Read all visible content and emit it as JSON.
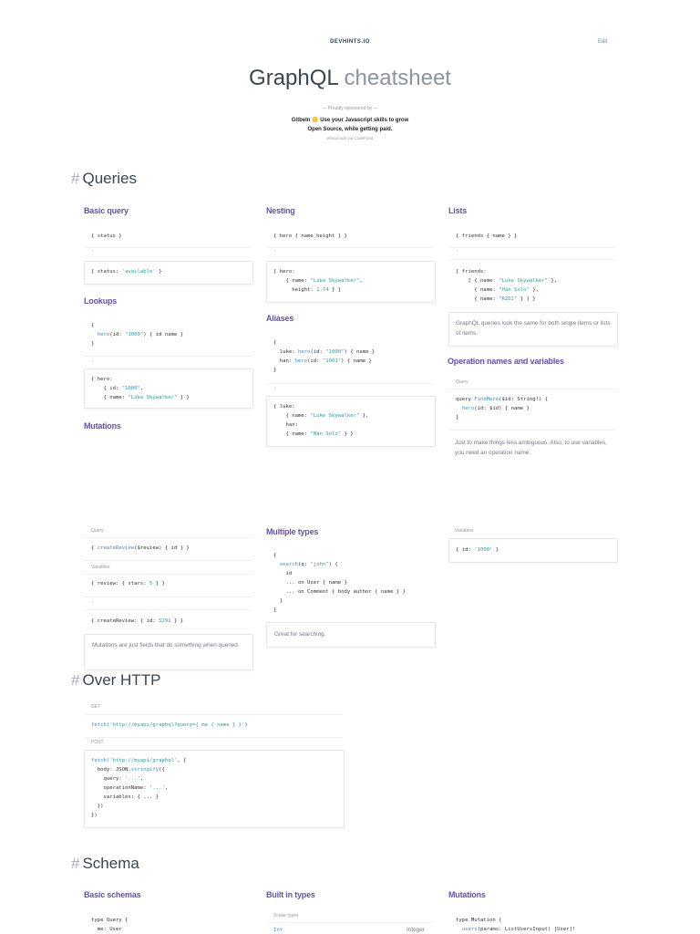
{
  "header": {
    "brand": "DEVHINTS.IO",
    "edit": "Edit",
    "title_main": "GraphQL",
    "title_light": "cheatsheet"
  },
  "sponsor": {
    "label": "— Proudly sponsored by —",
    "line1": "Gitbeln 🪙 Use your Javascript skills to grow",
    "line2": "Open Source, while getting paid.",
    "footer": "ethical ads via CodeFund"
  },
  "sections": {
    "queries": "Queries",
    "http": "Over HTTP",
    "schema": "Schema"
  },
  "arrow": "↓",
  "queries": {
    "basic": {
      "title": "Basic query",
      "q": [
        [
          [
            "{ status }",
            ""
          ]
        ]
      ],
      "r": [
        [
          [
            "{ status: ",
            ""
          ],
          [
            "'available'",
            "s"
          ],
          [
            " }",
            ""
          ]
        ]
      ]
    },
    "lookups": {
      "title": "Lookups",
      "q": [
        [
          [
            "{",
            ""
          ]
        ],
        [
          [
            "  ",
            ""
          ],
          [
            "hero",
            "f"
          ],
          [
            "(id: ",
            ""
          ],
          [
            "\"1000\"",
            "s"
          ],
          [
            ") { id name }",
            ""
          ]
        ],
        [
          [
            "}",
            ""
          ]
        ]
      ],
      "r": [
        [
          [
            "{ hero:",
            ""
          ]
        ],
        [
          [
            "    { id: ",
            ""
          ],
          [
            "\"1000\"",
            "s"
          ],
          [
            ",",
            ""
          ]
        ],
        [
          [
            "    { name: ",
            ""
          ],
          [
            "\"Luke Skywalker\"",
            "s"
          ],
          [
            " } }",
            ""
          ]
        ]
      ]
    },
    "mutations": {
      "title": "Mutations",
      "query_label": "Query",
      "q": [
        [
          [
            "{ ",
            ""
          ],
          [
            "createReview",
            "f"
          ],
          [
            "($review) { id } }",
            ""
          ]
        ]
      ],
      "variables_label": "Variables",
      "v": [
        [
          [
            "{ review: { stars: ",
            ""
          ],
          [
            "5",
            "s"
          ],
          [
            " } }",
            ""
          ]
        ]
      ],
      "r": [
        [
          [
            "{ createReview: { id: ",
            ""
          ],
          [
            "5291",
            "s"
          ],
          [
            " } }",
            ""
          ]
        ]
      ],
      "note": "Mutations are just fields that do something when queried.",
      "vars_label2": "Variables",
      "v2": [
        [
          [
            "{ id: ",
            ""
          ],
          [
            "'1000'",
            "s"
          ],
          [
            " }",
            ""
          ]
        ]
      ]
    },
    "nesting": {
      "title": "Nesting",
      "q": [
        [
          [
            "{ hero { name height } }",
            ""
          ]
        ]
      ],
      "r": [
        [
          [
            "{ hero:",
            ""
          ]
        ],
        [
          [
            "    { name: ",
            ""
          ],
          [
            "\"Luke Skywalker\"",
            "s"
          ],
          [
            ",",
            ""
          ]
        ],
        [
          [
            "      height: ",
            ""
          ],
          [
            "1.74",
            "s"
          ],
          [
            " } }",
            ""
          ]
        ]
      ]
    },
    "aliases": {
      "title": "Aliases",
      "q": [
        [
          [
            "{",
            ""
          ]
        ],
        [
          [
            "  luke: ",
            ""
          ],
          [
            "hero",
            "f"
          ],
          [
            "(id: ",
            ""
          ],
          [
            "\"1000\"",
            "s"
          ],
          [
            ") { name }",
            ""
          ]
        ],
        [
          [
            "  han: ",
            ""
          ],
          [
            "hero",
            "f"
          ],
          [
            "(id: ",
            ""
          ],
          [
            "\"1001\"",
            "s"
          ],
          [
            ") { name }",
            ""
          ]
        ],
        [
          [
            "}",
            ""
          ]
        ]
      ],
      "r": [
        [
          [
            "{ luke:",
            ""
          ]
        ],
        [
          [
            "    { name: ",
            ""
          ],
          [
            "\"Luke Skywalker\"",
            "s"
          ],
          [
            " },",
            ""
          ]
        ],
        [
          [
            "    han:",
            ""
          ]
        ],
        [
          [
            "    { name: ",
            ""
          ],
          [
            "\"Han Solo\"",
            "s"
          ],
          [
            " } }",
            ""
          ]
        ]
      ]
    },
    "multiple": {
      "title": "Multiple types",
      "q": [
        [
          [
            "{",
            ""
          ]
        ],
        [
          [
            "  ",
            ""
          ],
          [
            "search",
            "f"
          ],
          [
            "(q: ",
            ""
          ],
          [
            "\"john\"",
            "s"
          ],
          [
            ") {",
            ""
          ]
        ],
        [
          [
            "    id",
            ""
          ]
        ],
        [
          [
            "    ... on User { name }",
            ""
          ]
        ],
        [
          [
            "    ... on Comment { body author { name } }",
            ""
          ]
        ],
        [
          [
            "  }",
            ""
          ]
        ],
        [
          [
            "}",
            ""
          ]
        ]
      ],
      "note": "Great for searching."
    },
    "lists": {
      "title": "Lists",
      "q": [
        [
          [
            "{ friends { name } }",
            ""
          ]
        ]
      ],
      "r": [
        [
          [
            "{ friends:",
            ""
          ]
        ],
        [
          [
            "    [ { name: ",
            ""
          ],
          [
            "\"Luke Skywalker\"",
            "s"
          ],
          [
            " },",
            ""
          ]
        ],
        [
          [
            "      { name: ",
            ""
          ],
          [
            "\"Han Solo\"",
            "s"
          ],
          [
            " },",
            ""
          ]
        ],
        [
          [
            "      { name: ",
            ""
          ],
          [
            "\"R2D2\"",
            "s"
          ],
          [
            " } ] }",
            ""
          ]
        ]
      ],
      "note": "GraphQL queries look the same for both single items or lists of items."
    },
    "operation": {
      "title": "Operation names and variables",
      "query_label": "Query",
      "q": [
        [
          [
            "query ",
            ""
          ],
          [
            "FindHero",
            "f"
          ],
          [
            "($id: String!) {",
            ""
          ]
        ],
        [
          [
            "  ",
            ""
          ],
          [
            "hero",
            "f"
          ],
          [
            "(id: $id) { name }",
            ""
          ]
        ],
        [
          [
            "}",
            ""
          ]
        ]
      ],
      "note": "Just to make things less ambiguous. Also, to use variables, you need an operation name."
    }
  },
  "http": {
    "get_label": "GET",
    "get": [
      [
        [
          "fetch(",
          "f"
        ],
        [
          "'http://myapi/graphql?query={ me { name } }'",
          "s"
        ],
        [
          ")",
          ""
        ]
      ]
    ],
    "post_label": "POST",
    "post": [
      [
        [
          "fetch(",
          "f"
        ],
        [
          "'http://myapi/graphql'",
          "s"
        ],
        [
          ", {",
          ""
        ]
      ],
      [
        [
          "  body: JSON.",
          ""
        ],
        [
          "stringify",
          "f"
        ],
        [
          "({",
          ""
        ]
      ],
      [
        [
          "    query: ",
          ""
        ],
        [
          "'...'",
          "s"
        ],
        [
          ",",
          ""
        ]
      ],
      [
        [
          "    operationName: ",
          ""
        ],
        [
          "'...'",
          "s"
        ],
        [
          ",",
          ""
        ]
      ],
      [
        [
          "    variables: { ... }",
          ""
        ]
      ],
      [
        [
          "  })",
          ""
        ]
      ],
      [
        [
          "})",
          ""
        ]
      ]
    ]
  },
  "schema": {
    "basic": {
      "title": "Basic schemas",
      "code": [
        [
          [
            "type Query {",
            ""
          ]
        ],
        [
          [
            "  me: User",
            ""
          ]
        ]
      ]
    },
    "builtin": {
      "title": "Built in types",
      "scalar_label": "Scalar types",
      "rows": [
        {
          "name": "Int",
          "desc": "Integer"
        }
      ]
    },
    "mutations": {
      "title": "Mutations",
      "code": [
        [
          [
            "type Mutation {",
            ""
          ]
        ],
        [
          [
            "  ",
            ""
          ],
          [
            "users",
            "f"
          ],
          [
            "(params: ListUsersInput) [User]!",
            ""
          ]
        ]
      ]
    }
  }
}
